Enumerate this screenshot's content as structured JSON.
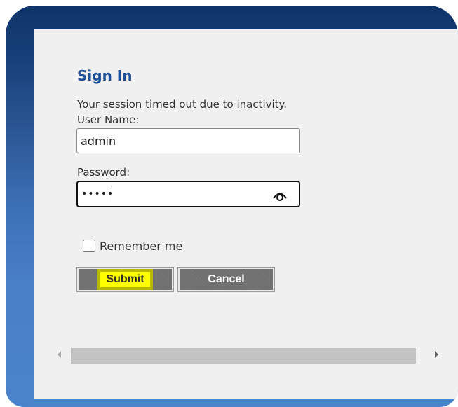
{
  "signin": {
    "title": "Sign In",
    "message": "Your session timed out due to inactivity.",
    "username_label": "User Name:",
    "username_value": "admin",
    "password_label": "Password:",
    "password_masked": "•••••",
    "show_password_icon": "eye-icon",
    "remember_label": "Remember me",
    "remember_checked": false,
    "submit_label": "Submit",
    "cancel_label": "Cancel"
  },
  "scrollbar": {
    "left_arrow_icon": "chevron-left-icon",
    "right_arrow_icon": "chevron-right-icon"
  },
  "colors": {
    "frame_top": "#0e336a",
    "frame_bottom": "#4a82cc",
    "title": "#1f4f97",
    "panel": "#f0f0f0",
    "button": "#6e6e6e",
    "submit_highlight": "#ffff00"
  }
}
